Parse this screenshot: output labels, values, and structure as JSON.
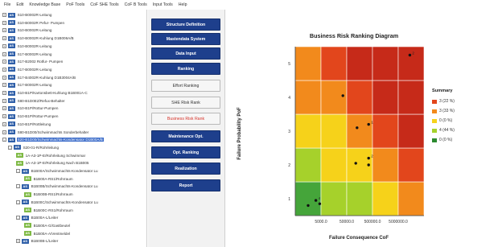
{
  "menu": [
    "File",
    "Edit",
    "Knowledge Base",
    "PoF Tools",
    "CoF SHE Tools",
    "CoF B Tools",
    "Input Tools",
    "Help"
  ],
  "tree": {
    "rows": [
      {
        "exp": "+",
        "badge": "AS",
        "color": "blue",
        "text": "S10-B0002R-Leitung"
      },
      {
        "exp": "+",
        "badge": "AS",
        "color": "blue",
        "text": "S10-B0002R Pefur- Pumpen"
      },
      {
        "exp": "+",
        "badge": "AS",
        "color": "blue",
        "text": "S10-B0002R-Leitung"
      },
      {
        "exp": "+",
        "badge": "AS",
        "color": "blue",
        "text": "S10-B0002R-Kuhlung D1B006A/B"
      },
      {
        "exp": "+",
        "badge": "AS",
        "color": "blue",
        "text": "S10-B0002R-Leitung"
      },
      {
        "exp": "+",
        "badge": "AS",
        "color": "blue",
        "text": "S17-B0002R-Leitung"
      },
      {
        "exp": "+",
        "badge": "AS",
        "color": "blue",
        "text": "S17-B2002 Rotfur- Pumpen"
      },
      {
        "exp": "+",
        "badge": "AS",
        "color": "blue",
        "text": "S17-B0002R-Leitung"
      },
      {
        "exp": "+",
        "badge": "AS",
        "color": "blue",
        "text": "S17-B4002R-Kuhlung D1B3004A/B"
      },
      {
        "exp": "+",
        "badge": "AS",
        "color": "blue",
        "text": "S17-B0002R-Leitung"
      },
      {
        "exp": "+",
        "badge": "AS",
        "color": "blue",
        "text": "S10-B1P/Kartonsbett-Kuhlung B1B001A-C"
      },
      {
        "exp": "+",
        "badge": "AS",
        "color": "blue",
        "text": "S80-B1D0EZ/Refux-Behalter"
      },
      {
        "exp": "+",
        "badge": "AS",
        "color": "blue",
        "text": "S10-B1P/Rottur-Pumpen"
      },
      {
        "exp": "+",
        "badge": "AS",
        "color": "blue",
        "text": "S10-B1P/Rottur-Pumpen"
      },
      {
        "exp": "+",
        "badge": "AS",
        "color": "blue",
        "text": "S10-B1P/Rottleitung"
      },
      {
        "exp": "+",
        "badge": "AS",
        "color": "blue",
        "text": "S80-B1D00/Schwimmachts Sonderbehalter"
      },
      {
        "exp": "-",
        "badge": "AS",
        "color": "blue",
        "text": "S20-B1D00/Schwimmachts-Kondensator D1B00A/B",
        "selected": true
      },
      {
        "exp": "-",
        "badge": "AS",
        "color": "blue",
        "text": "S20-01-R/Rohrleitung"
      },
      {
        "exp": "",
        "badge": "AS",
        "color": "green",
        "text": "1A-A3-1P-E/Rohrleitung Schwimmar"
      },
      {
        "exp": "",
        "badge": "AS",
        "color": "green",
        "text": "1A-A3-1P-E/Rohrleitung Nach B1B005"
      },
      {
        "exp": "-",
        "badge": "AS",
        "color": "blue",
        "text": "B1B00A/Schwimmachts-Kondensator Lu"
      },
      {
        "exp": "",
        "badge": "AS",
        "color": "green",
        "text": "B1B00A-RS1/Rohrraum"
      },
      {
        "exp": "-",
        "badge": "AS",
        "color": "blue",
        "text": "B1B00B/Schwimmachts-Kondensator Lu"
      },
      {
        "exp": "",
        "badge": "AS",
        "color": "green",
        "text": "B1B00B-RS1/Rohrraum"
      },
      {
        "exp": "-",
        "badge": "AS",
        "color": "blue",
        "text": "B1B00C/Schwimmachts-Kondensator Lu"
      },
      {
        "exp": "",
        "badge": "AS",
        "color": "green",
        "text": "B1B00C-RS1/Rohrraum"
      },
      {
        "exp": "-",
        "badge": "AS",
        "color": "blue",
        "text": "B1B00A-L/Leiter"
      },
      {
        "exp": "",
        "badge": "AS",
        "color": "green",
        "text": "B1B00A-G/Gastbeutel"
      },
      {
        "exp": "",
        "badge": "AS",
        "color": "green",
        "text": "B1B00A-A/Ventmeldel"
      },
      {
        "exp": "+",
        "badge": "AS",
        "color": "blue",
        "text": "B1B00B-L/Leiter"
      }
    ]
  },
  "buttons": [
    {
      "label": "Structure Definition",
      "style": "dark"
    },
    {
      "label": "Mastendata System",
      "style": "dark"
    },
    {
      "label": "Data Input",
      "style": "dark"
    },
    {
      "label": "Ranking",
      "style": "dark"
    },
    {
      "label": "Effort Ranking",
      "style": "light"
    },
    {
      "label": "SHE Risk Rank",
      "style": "light"
    },
    {
      "label": "Business Risk Rank",
      "style": "active"
    },
    {
      "label": "Maintenance Opt.",
      "style": "dark"
    },
    {
      "label": "Opt. Ranking",
      "style": "dark"
    },
    {
      "label": "Realization",
      "style": "dark"
    },
    {
      "label": "Report",
      "style": "dark"
    }
  ],
  "chart": {
    "title": "Business Risk Ranking Diagram",
    "xlabel": "Failure Consequence CoF",
    "ylabel": "Failure Probability PoF",
    "x_ticks": [
      "5000.0",
      "50000.0",
      "500000.0",
      "5000000.0"
    ],
    "y_ticks": [
      "1",
      "2",
      "3",
      "4",
      "5"
    ],
    "colors": {
      "dark_red": "#c62a19",
      "red": "#e2461c",
      "orange": "#f28a1c",
      "yellow": "#f6d21a",
      "lime": "#a6d12b",
      "green": "#45a53a",
      "dark_green": "#2b8a2f"
    }
  },
  "chart_data": {
    "type": "heatmap",
    "title": "Business Risk Ranking Diagram",
    "xlabel": "Failure Consequence CoF",
    "ylabel": "Failure Probability PoF",
    "x_categories": [
      "5000.0",
      "50000.0",
      "500000.0",
      "5000000.0"
    ],
    "y_categories": [
      "1",
      "2",
      "3",
      "4",
      "5"
    ],
    "cells": [
      [
        "green",
        "lime",
        "lime",
        "yellow",
        "orange"
      ],
      [
        "lime",
        "yellow",
        "yellow",
        "orange",
        "red"
      ],
      [
        "yellow",
        "yellow",
        "orange",
        "red",
        "dark_red"
      ],
      [
        "orange",
        "orange",
        "red",
        "dark_red",
        "dark_red"
      ],
      [
        "orange",
        "red",
        "dark_red",
        "dark_red",
        "dark_red"
      ]
    ],
    "points": [
      {
        "col": 0.5,
        "row": 0.3,
        "label": ""
      },
      {
        "col": 0.8,
        "row": 0.45,
        "label": "4"
      },
      {
        "col": 0.95,
        "row": 0.35,
        "label": ""
      },
      {
        "col": 2.85,
        "row": 2.7,
        "label": "1"
      },
      {
        "col": 2.4,
        "row": 2.6,
        "label": ""
      },
      {
        "col": 2.85,
        "row": 1.7,
        "label": "2"
      },
      {
        "col": 2.85,
        "row": 1.5,
        "label": ""
      },
      {
        "col": 2.35,
        "row": 1.55,
        "label": ""
      },
      {
        "col": 1.85,
        "row": 3.55,
        "label": ""
      },
      {
        "col": 4.45,
        "row": 4.75,
        "label": "2"
      }
    ],
    "legend": {
      "title": "Summary",
      "items": [
        {
          "label": "3 (22 %)",
          "color": "#e2461c"
        },
        {
          "label": "3 (33 %)",
          "color": "#f28a1c"
        },
        {
          "label": "0 (0 %)",
          "color": "#f6d21a"
        },
        {
          "label": "4 (44 %)",
          "color": "#a6d12b"
        },
        {
          "label": "0 (0 %)",
          "color": "#2b8a2f"
        }
      ]
    }
  }
}
